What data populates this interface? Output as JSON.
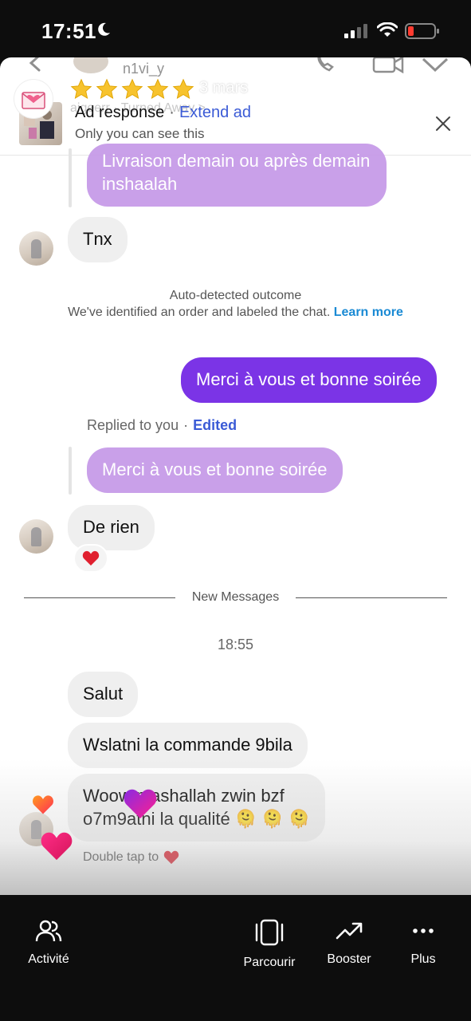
{
  "status_bar": {
    "time": "17:51",
    "battery_color": "#ff3b30"
  },
  "story": {
    "username": "n1vi_y",
    "rating_stars": 5,
    "date": "3 mars",
    "meta": "aigeerr · Turned Away >"
  },
  "ad_banner": {
    "title": "Ad response",
    "separator": "·",
    "extend_link": "Extend ad",
    "subtitle": "Only you can see this"
  },
  "messages": {
    "quoted_top": "Livraison demain ou après demain inshaalah",
    "tnx": "Tnx",
    "outcome": {
      "title": "Auto-detected outcome",
      "text": "We've identified an order and labeled the chat. ",
      "learn_more": "Learn more"
    },
    "sent_merci": "Merci à vous et bonne soirée",
    "replied_label": "Replied to you",
    "replied_sep": "·",
    "edited_label": "Edited",
    "quoted_merci": "Merci à vous et bonne soirée",
    "de_rien": "De rien",
    "new_messages": "New Messages",
    "time": "18:55",
    "salut": "Salut",
    "wslatni": "Wslatni la commande 9bila",
    "woow_line1": "Woow mashallah zwin bzf",
    "woow_line2": "o7m9atni la qualité 🫠 🫠 🫠",
    "double_tap": "Double tap to"
  },
  "bottom_nav": {
    "activite": "Activité",
    "parcourir": "Parcourir",
    "booster": "Booster",
    "plus": "Plus"
  },
  "colors": {
    "sent_bubble": "#7b34e6",
    "quoted_bubble": "#c79be8",
    "link_blue": "#3b5bd6",
    "learn_more": "#1a8ad4"
  }
}
